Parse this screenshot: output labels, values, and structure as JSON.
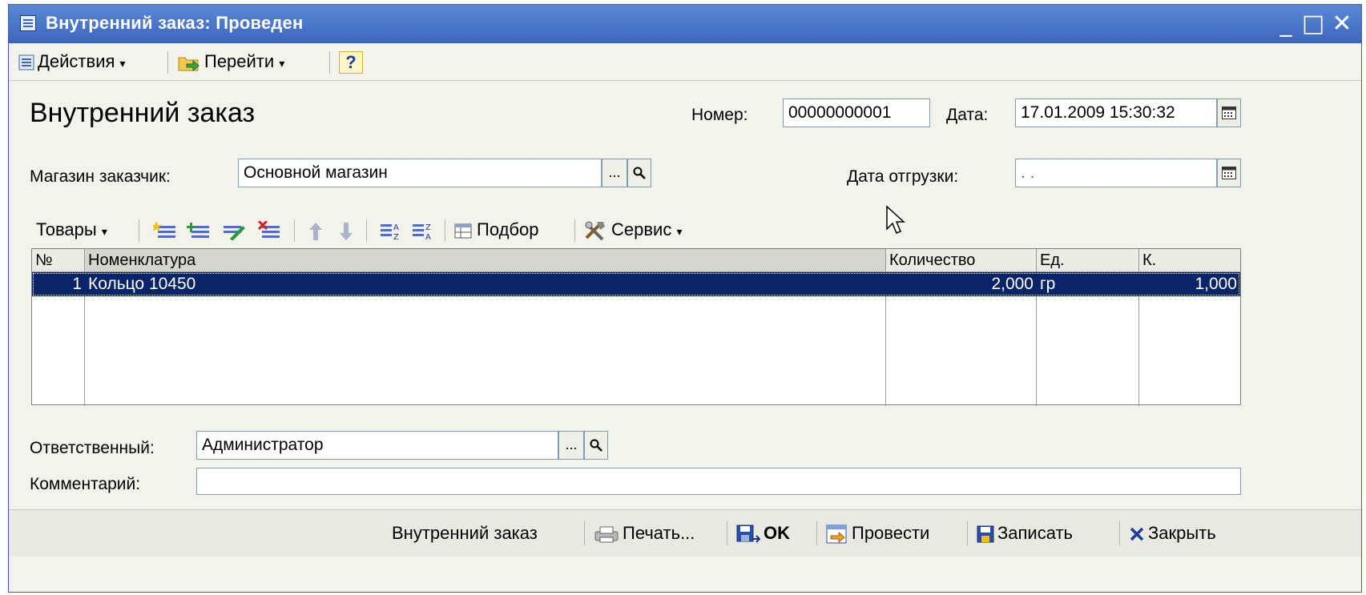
{
  "window": {
    "title": "Внутренний заказ: Проведен",
    "minimize": "_",
    "maximize": "□",
    "close": "✕"
  },
  "toolbar": {
    "actions": "Действия",
    "goto": "Перейти",
    "help": "?"
  },
  "form": {
    "heading": "Внутренний заказ",
    "number_label": "Номер:",
    "number_value": "00000000001",
    "date_label": "Дата:",
    "date_value": "17.01.2009 15:30:32",
    "store_label": "Магазин заказчик:",
    "store_value": "Основной магазин",
    "ship_date_label": "Дата отгрузки:",
    "ship_date_value": " .  . ",
    "responsible_label": "Ответственный:",
    "responsible_value": "Администратор",
    "comment_label": "Комментарий:",
    "comment_value": "",
    "select_button": "...",
    "search_icon": "magnifier-icon"
  },
  "goods_toolbar": {
    "goods": "Товары",
    "selection": "Подбор",
    "service": "Сервис"
  },
  "table": {
    "columns": [
      "№",
      "Номенклатура",
      "Количество",
      "Ед.",
      "К."
    ],
    "rows": [
      {
        "n": "1",
        "item": "Кольцо 10450",
        "qty": "2,000",
        "unit": "гр",
        "k": "1,000"
      }
    ]
  },
  "bottom": {
    "doc": "Внутренний заказ",
    "print": "Печать...",
    "ok": "OK",
    "post": "Провести",
    "save": "Записать",
    "close": "Закрыть"
  },
  "colors": {
    "title_bar": "#3c66bc",
    "selected_row": "#0a246a",
    "window_bg": "#f3f3ec"
  }
}
